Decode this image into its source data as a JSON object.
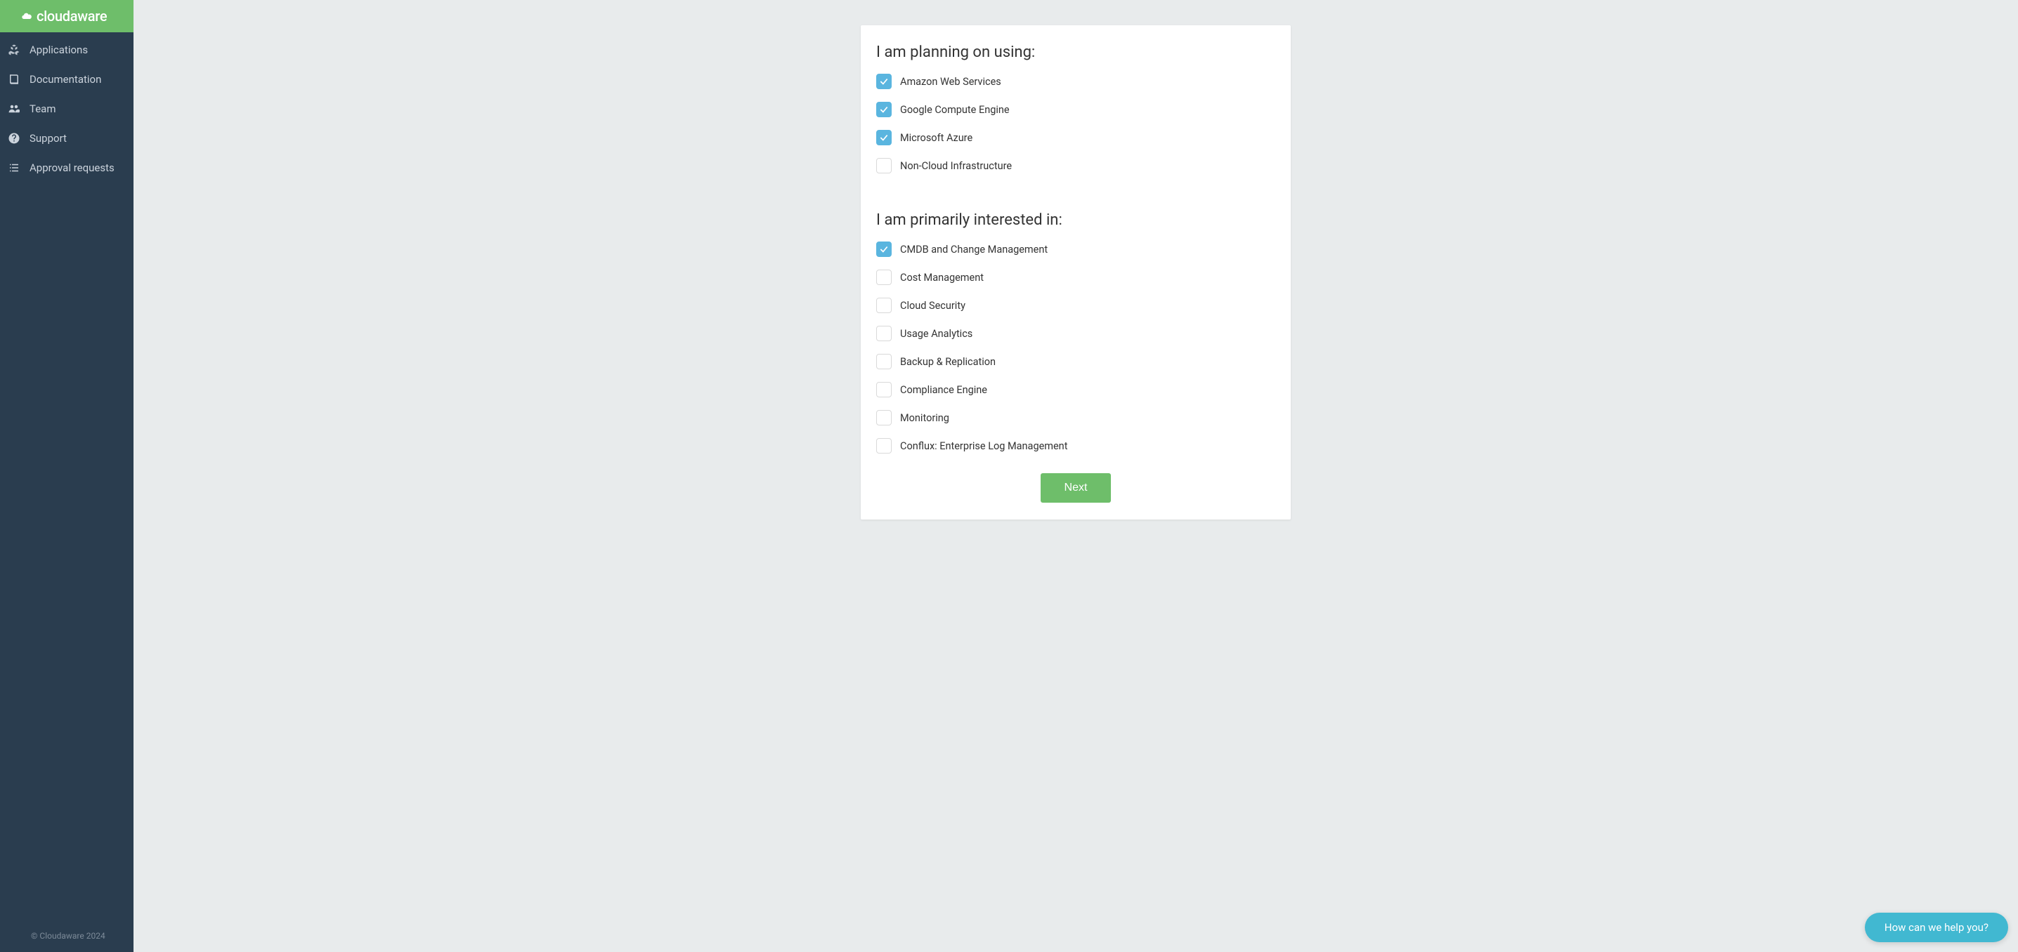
{
  "brand": {
    "name": "cloudaware"
  },
  "sidebar": {
    "items": [
      {
        "label": "Applications"
      },
      {
        "label": "Documentation"
      },
      {
        "label": "Team"
      },
      {
        "label": "Support"
      },
      {
        "label": "Approval requests"
      }
    ]
  },
  "footer": {
    "text": "© Cloudaware 2024"
  },
  "form": {
    "section1": {
      "title": "I am planning on using:",
      "options": [
        {
          "label": "Amazon Web Services",
          "checked": true
        },
        {
          "label": "Google Compute Engine",
          "checked": true
        },
        {
          "label": "Microsoft Azure",
          "checked": true
        },
        {
          "label": "Non-Cloud Infrastructure",
          "checked": false
        }
      ]
    },
    "section2": {
      "title": "I am primarily interested in:",
      "options": [
        {
          "label": "CMDB and Change Management",
          "checked": true
        },
        {
          "label": "Cost Management",
          "checked": false
        },
        {
          "label": "Cloud Security",
          "checked": false
        },
        {
          "label": "Usage Analytics",
          "checked": false
        },
        {
          "label": "Backup & Replication",
          "checked": false
        },
        {
          "label": "Compliance Engine",
          "checked": false
        },
        {
          "label": "Monitoring",
          "checked": false
        },
        {
          "label": "Conflux: Enterprise Log Management",
          "checked": false
        }
      ]
    },
    "next_label": "Next"
  },
  "chat": {
    "prompt": "How can we help you?"
  }
}
